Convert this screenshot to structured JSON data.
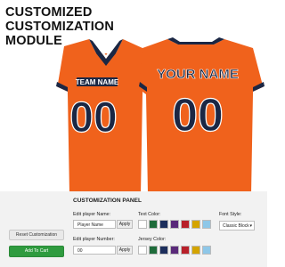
{
  "heading": {
    "line1": "CUSTOMIZED",
    "line2": "CUSTOMIZATION",
    "line3": "MODULE"
  },
  "jersey": {
    "team_name": "TEAM NAME",
    "player_name": "YOUR NAME",
    "front_number": "00",
    "back_number": "00",
    "colors": {
      "body": "#f0621c",
      "trim": "#1b2744",
      "stripe": "#ffffff",
      "text_outline": "#ffffff"
    }
  },
  "panel": {
    "title": "CUSTOMIZATION PANEL",
    "reset_label": "Reset Customization",
    "cart_label": "Add To Cart",
    "player_name_label": "Edit player Name:",
    "player_name_value": "Player Name",
    "player_number_label": "Edit player Number:",
    "player_number_value": "00",
    "apply_label": "Apply",
    "text_color_label": "Text Color:",
    "jersey_color_label": "Jersey Color:",
    "font_style_label": "Font Style:",
    "font_style_value": "Classic Block",
    "text_colors": [
      "#ffffff",
      "#1e6b3a",
      "#1c2e5c",
      "#5a2a7a",
      "#b8202a",
      "#d4a400",
      "#8ec7e8"
    ],
    "jersey_colors": [
      "#ffffff",
      "#1e6b3a",
      "#1c2e5c",
      "#5a2a7a",
      "#b8202a",
      "#d4a400",
      "#8ec7e8"
    ]
  }
}
